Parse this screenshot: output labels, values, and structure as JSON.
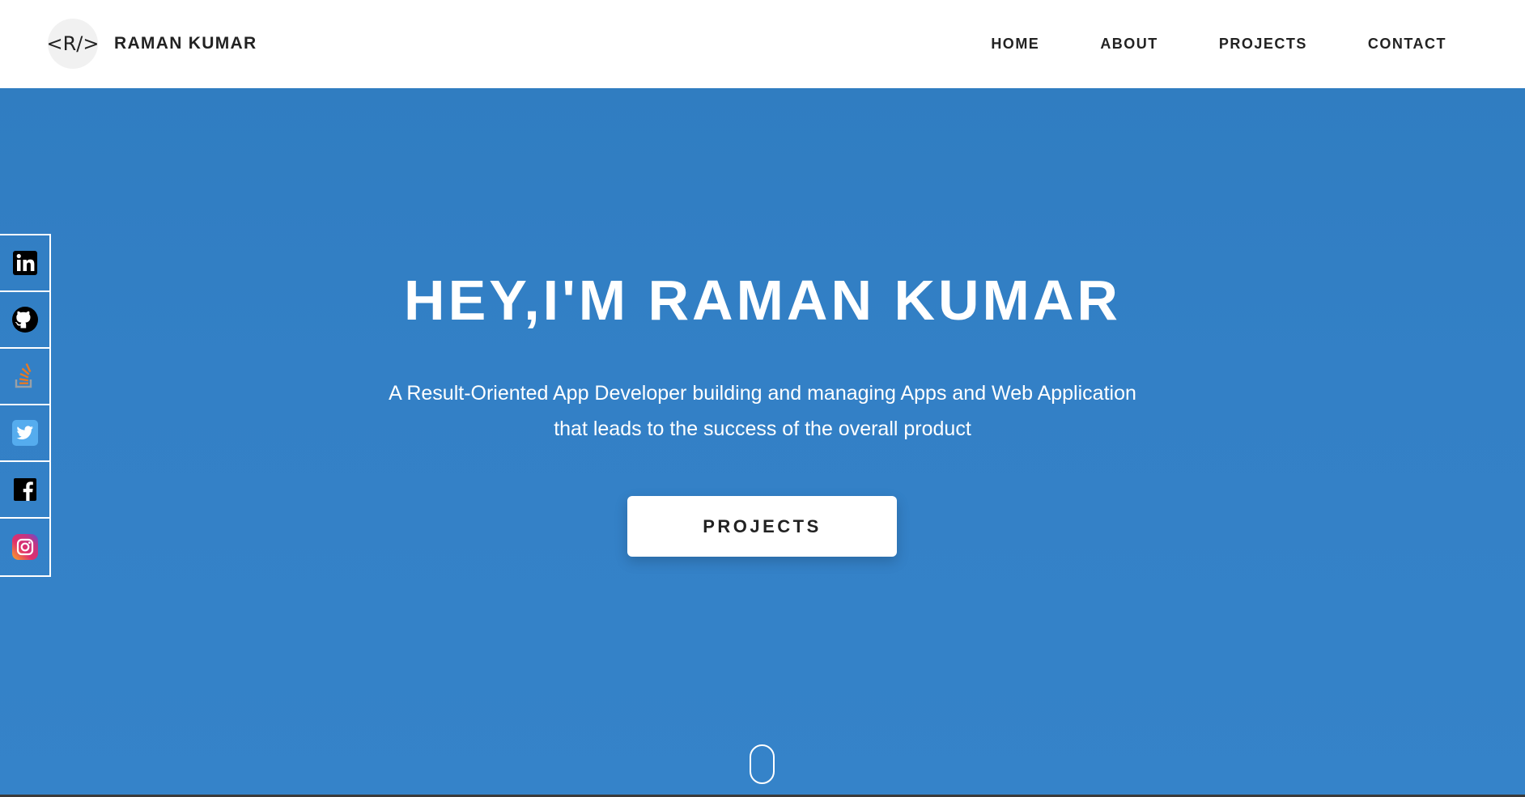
{
  "header": {
    "logo_text": "<R/>",
    "brand_name": "RAMAN KUMAR",
    "nav": [
      {
        "label": "HOME"
      },
      {
        "label": "ABOUT"
      },
      {
        "label": "PROJECTS"
      },
      {
        "label": "CONTACT"
      }
    ]
  },
  "hero": {
    "title": "HEY,I'M RAMAN KUMAR",
    "subtitle_line1": "A Result-Oriented App Developer building and managing Apps and Web Application",
    "subtitle_line2": "that leads to the success of the overall product",
    "cta_label": "PROJECTS"
  },
  "social": [
    {
      "icon": "linkedin-icon"
    },
    {
      "icon": "github-icon"
    },
    {
      "icon": "stackoverflow-icon"
    },
    {
      "icon": "twitter-icon"
    },
    {
      "icon": "facebook-icon"
    },
    {
      "icon": "instagram-icon"
    }
  ],
  "colors": {
    "hero_bg": "#3380c6",
    "text_dark": "#222222",
    "white": "#ffffff",
    "stackoverflow": "#e87922",
    "twitter": "#55acee"
  }
}
